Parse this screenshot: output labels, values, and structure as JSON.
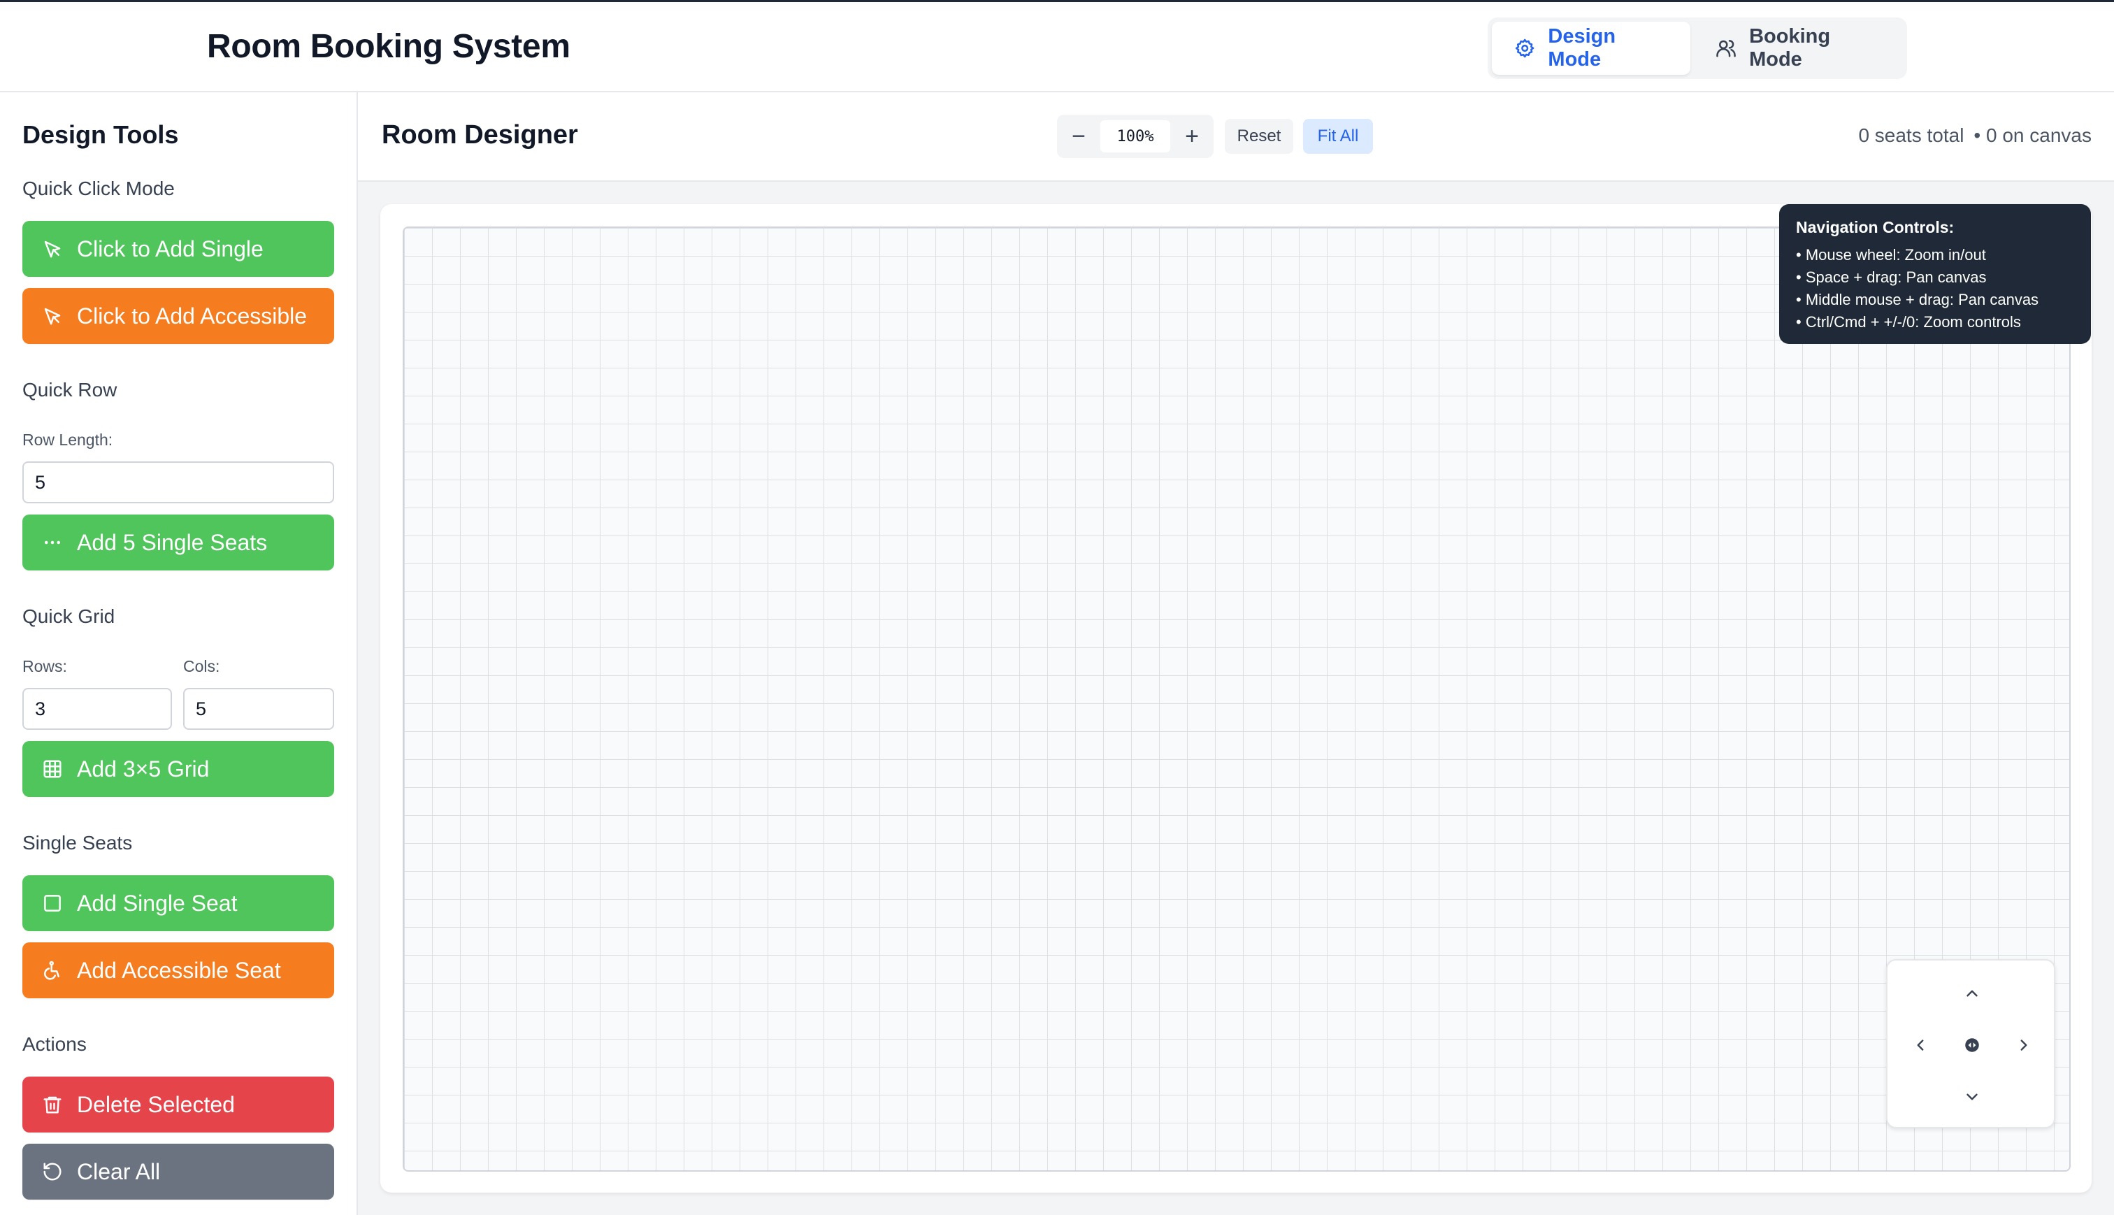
{
  "header": {
    "title": "Room Booking System",
    "modes": [
      {
        "label": "Design Mode",
        "icon": "gear-icon",
        "active": true
      },
      {
        "label": "Booking Mode",
        "icon": "users-icon",
        "active": false
      }
    ]
  },
  "sidebar": {
    "title": "Design Tools",
    "quick_click": {
      "label": "Quick Click Mode",
      "add_single": "Click to Add Single",
      "add_accessible": "Click to Add Accessible"
    },
    "quick_row": {
      "label": "Quick Row",
      "row_length_label": "Row Length:",
      "row_length_value": "5",
      "add_button": "Add 5 Single Seats"
    },
    "quick_grid": {
      "label": "Quick Grid",
      "rows_label": "Rows:",
      "rows_value": "3",
      "cols_label": "Cols:",
      "cols_value": "5",
      "add_button": "Add 3×5 Grid"
    },
    "single_seats": {
      "label": "Single Seats",
      "add_single": "Add Single Seat",
      "add_accessible": "Add Accessible Seat"
    },
    "actions": {
      "label": "Actions",
      "delete": "Delete Selected",
      "clear": "Clear All"
    }
  },
  "main": {
    "title": "Room Designer",
    "zoom": {
      "minus": "−",
      "value": "100%",
      "plus": "+"
    },
    "reset_label": "Reset",
    "fit_all_label": "Fit All",
    "seats_total": "0 seats total",
    "on_canvas": "• 0 on canvas"
  },
  "navigation_help": {
    "title": "Navigation Controls:",
    "items": [
      "• Mouse wheel: Zoom in/out",
      "• Space + drag: Pan canvas",
      "• Middle mouse + drag: Pan canvas",
      "• Ctrl/Cmd + +/-/0: Zoom controls"
    ]
  },
  "colors": {
    "green": "#4fc55c",
    "orange": "#f57c1f",
    "red": "#e5444a",
    "gray": "#6b7280",
    "accent": "#2563eb",
    "dark": "#1f2937"
  }
}
